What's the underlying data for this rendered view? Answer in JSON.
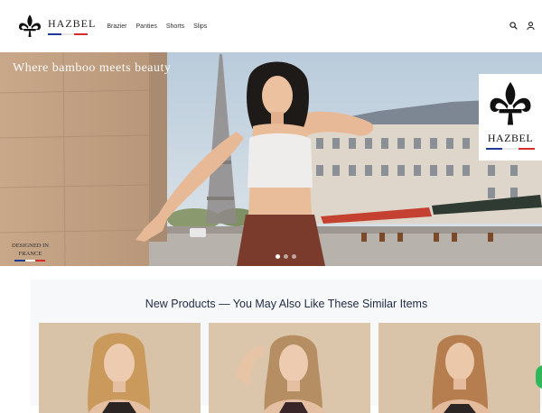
{
  "header": {
    "brand": "HAZBEL",
    "nav": [
      "Brazier",
      "Panties",
      "Shorts",
      "Slips"
    ],
    "icons": [
      "search-icon",
      "user-icon"
    ]
  },
  "hero": {
    "tagline": "Where bamboo meets beauty",
    "designed_line1": "DESIGNED IN",
    "designed_line2": "FRANCE",
    "brand_box_name": "HAZBEL",
    "slides": {
      "count": 3,
      "active": 1
    }
  },
  "products": {
    "title": "New Products — You May Also Like These Similar Items",
    "cards": 3
  },
  "colors": {
    "flag_blue": "#1f3a93",
    "flag_white": "#ffffff",
    "flag_red": "#d62b2b",
    "title_navy": "#222d45",
    "chat_green": "#2fb85a"
  }
}
